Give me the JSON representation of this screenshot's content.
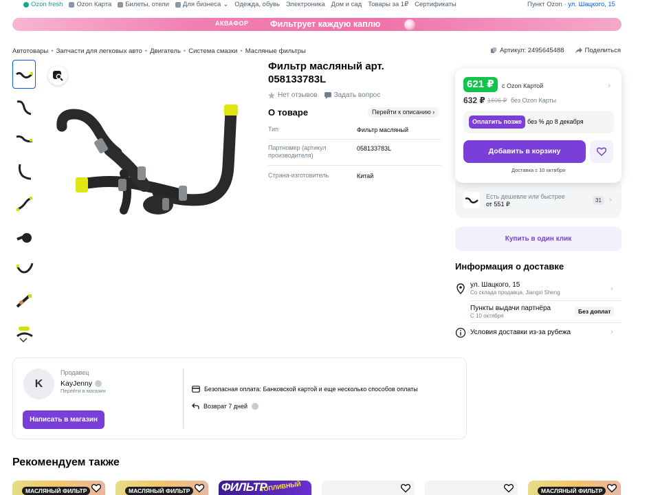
{
  "topnav": {
    "links": [
      "Ozon fresh",
      "Ozon Карта",
      "Билеты, отели",
      "Для бизнеса",
      "Одежда, обувь",
      "Электроника",
      "Дом и сад",
      "Товары за 1₽",
      "Сертификаты"
    ],
    "pickup_label": "Пункт Ozon ·",
    "pickup_address": "ул. Шацкого, 15"
  },
  "banner": {
    "brand": "АКВАФОР",
    "slogan": "Фильтрует каждую каплю"
  },
  "breadcrumbs": [
    "Автотовары",
    "Запчасти для легковых авто",
    "Двигатель",
    "Система смазки",
    "Масляные фильтры"
  ],
  "article": "Артикул: 2495645488",
  "share": "Поделиться",
  "product": {
    "title": "Фильтр масляный арт. 058133783L",
    "reviews": "Нет отзывов",
    "ask": "Задать вопрос",
    "about_heading": "О товаре",
    "to_description": "Перейти к описанию",
    "specs": [
      {
        "key": "Тип",
        "value": "Фильтр масляный"
      },
      {
        "key": "Партномер (артикул производителя)",
        "value": "058133783L"
      },
      {
        "key": "Страна-изготовитель",
        "value": "Китай"
      }
    ]
  },
  "price": {
    "card_price": "621 ₽",
    "card_label": "с Ozon Картой",
    "regular_price": "632 ₽",
    "old_price": "1606 ₽",
    "regular_label": "без Ozon Карты",
    "pay_later_button": "Оплатить позже",
    "pay_later_text": "без % до 8 декабря",
    "add_to_cart": "Добавить в корзину",
    "delivery_date": "Доставка с 10 октября"
  },
  "cheaper": {
    "text": "Есть дешевле или быстрее",
    "from": "от 551 ₽",
    "count": "31"
  },
  "one_click": "Купить в один клик",
  "delivery": {
    "heading": "Информация о доставке",
    "address": "ул. Шацкого, 15",
    "warehouse": "Со склада продавца, Jiangxi Sheng",
    "partner_points": "Пункты выдачи партнёра",
    "partner_date": "С 10 октября",
    "no_fee": "Без доплат",
    "abroad": "Условия доставки из-за рубежа"
  },
  "seller": {
    "label": "Продавец",
    "initial": "K",
    "name": "KayJenny",
    "go_to_shop": "Перейти в магазин",
    "write_button": "Написать в магазин",
    "payment": "Безопасная оплата: Банковской картой и еще несколько способов оплаты",
    "returns": "Возврат 7 дней"
  },
  "recommended": {
    "heading": "Рекомендуем также",
    "cards": [
      {
        "tag": "МАСЛЯНЫЙ ФИЛЬТР",
        "style": "yellow"
      },
      {
        "tag": "МАСЛЯНЫЙ ФИЛЬТР",
        "style": "yellow"
      },
      {
        "tag": "ФИЛЬТР",
        "sub": "ТОПЛИВНЫЙ",
        "style": "purple"
      },
      {
        "tag": "",
        "style": "gray"
      },
      {
        "tag": "",
        "style": "gray"
      },
      {
        "tag": "МАСЛЯНЫЙ ФИЛЬТР",
        "style": "yellow"
      }
    ]
  },
  "colors": {
    "accent": "#7b3fd9",
    "price_green": "#10c44c",
    "link_blue": "#005bff"
  }
}
